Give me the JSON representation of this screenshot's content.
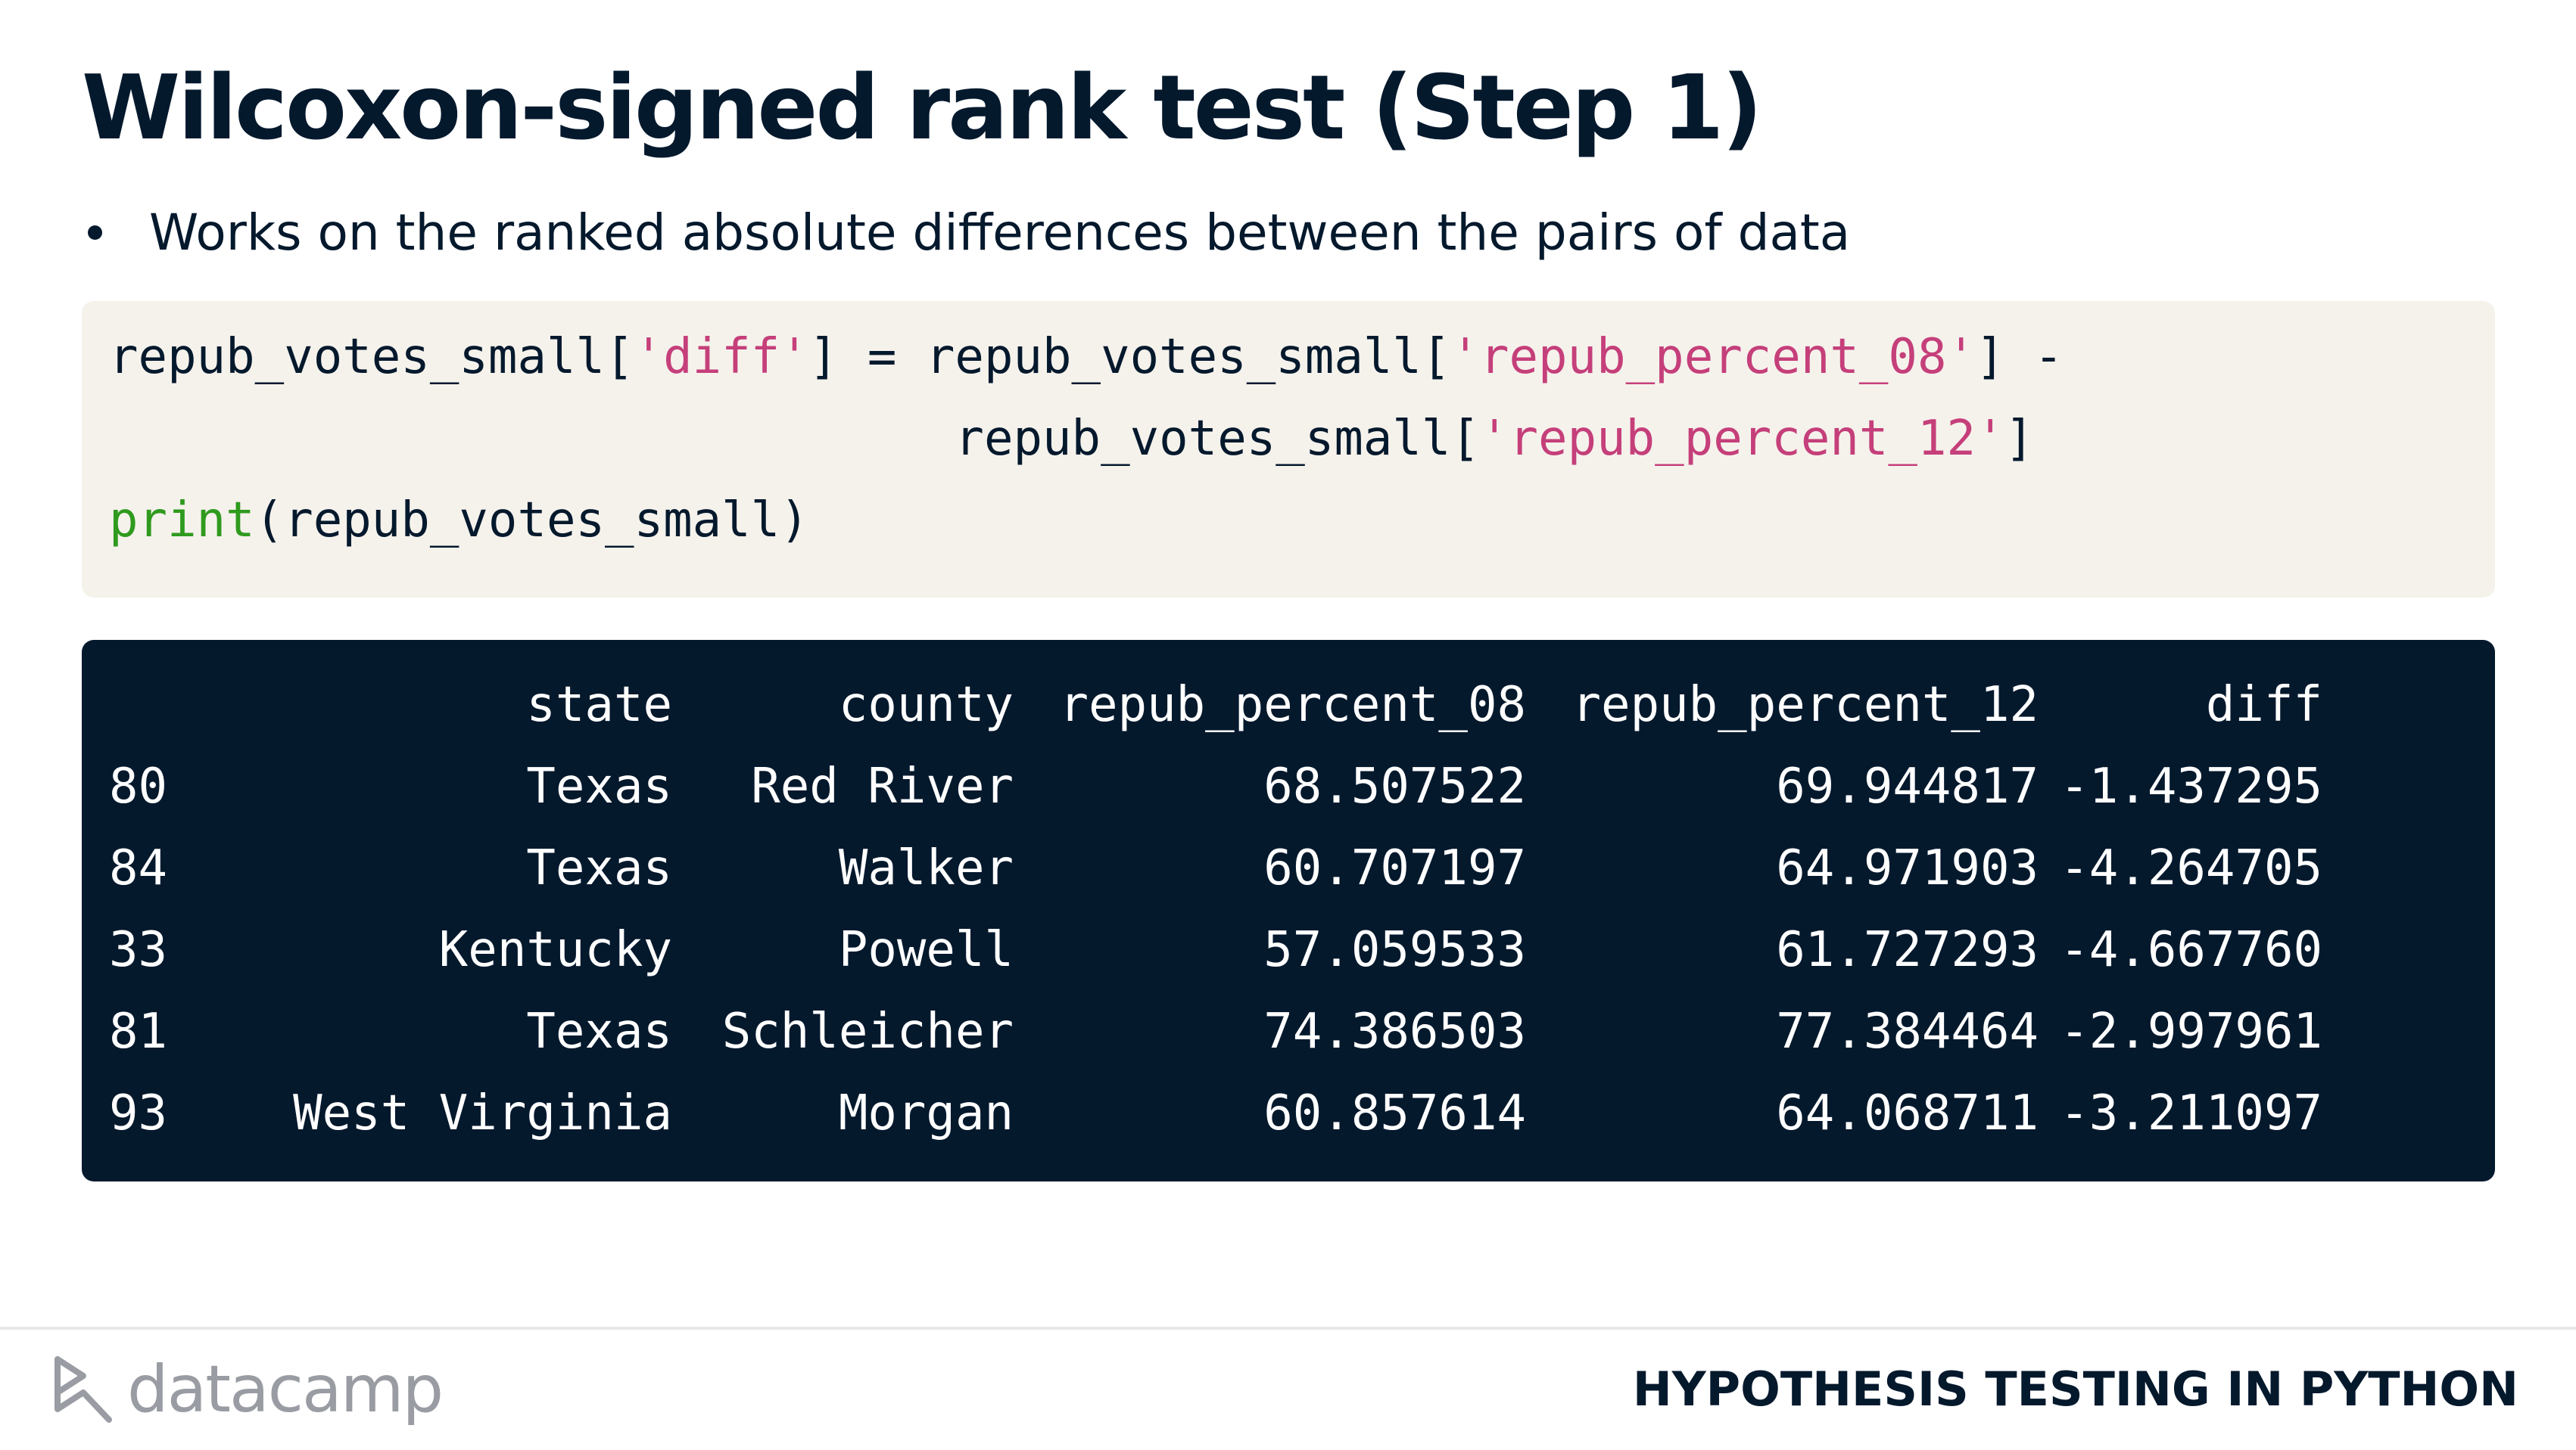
{
  "slide": {
    "title": "Wilcoxon-signed rank test (Step 1)",
    "bullets": [
      "Works on the ranked absolute differences between the pairs of data"
    ]
  },
  "code": {
    "line1": {
      "p1": "repub_votes_small[",
      "s1": "'diff'",
      "p2": "] = repub_votes_small[",
      "s2": "'repub_percent_08'",
      "p3": "] -"
    },
    "line2": {
      "p1": "                             repub_votes_small[",
      "s1": "'repub_percent_12'",
      "p2": "]"
    },
    "line3": {
      "fn": "print",
      "rest": "(repub_votes_small)"
    }
  },
  "output": {
    "columns": [
      "state",
      "county",
      "repub_percent_08",
      "repub_percent_12",
      "diff"
    ],
    "rows": [
      {
        "index": "80",
        "state": "Texas",
        "county": "Red River",
        "repub_percent_08": "68.507522",
        "repub_percent_12": "69.944817",
        "diff": "-1.437295"
      },
      {
        "index": "84",
        "state": "Texas",
        "county": "Walker",
        "repub_percent_08": "60.707197",
        "repub_percent_12": "64.971903",
        "diff": "-4.264705"
      },
      {
        "index": "33",
        "state": "Kentucky",
        "county": "Powell",
        "repub_percent_08": "57.059533",
        "repub_percent_12": "61.727293",
        "diff": "-4.667760"
      },
      {
        "index": "81",
        "state": "Texas",
        "county": "Schleicher",
        "repub_percent_08": "74.386503",
        "repub_percent_12": "77.384464",
        "diff": "-2.997961"
      },
      {
        "index": "93",
        "state": "West Virginia",
        "county": "Morgan",
        "repub_percent_08": "60.857614",
        "repub_percent_12": "64.068711",
        "diff": "-3.211097"
      }
    ]
  },
  "footer": {
    "logo_text": "datacamp",
    "logo_icon": "datacamp-logo-icon",
    "course_title": "HYPOTHESIS TESTING IN PYTHON"
  },
  "colors": {
    "navy": "#05192d",
    "code_bg": "#f5f2ec",
    "string": "#c53f7a",
    "function": "#2f9a1e",
    "logo_gray": "#9a9ca3"
  }
}
